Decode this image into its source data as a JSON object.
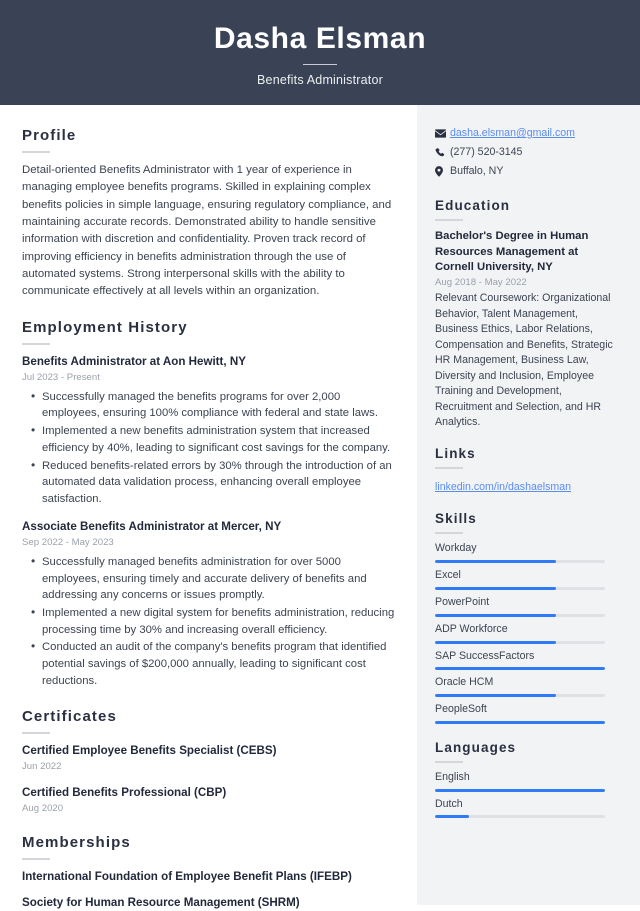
{
  "header": {
    "name": "Dasha Elsman",
    "job_title": "Benefits Administrator",
    "background_color": "#3a4355"
  },
  "accent_color": "#2f7bf6",
  "link_color": "#5b8dee",
  "main": {
    "profile": {
      "heading": "Profile",
      "text": "Detail-oriented Benefits Administrator with 1 year of experience in managing employee benefits programs. Skilled in explaining complex benefits policies in simple language, ensuring regulatory compliance, and maintaining accurate records. Demonstrated ability to handle sensitive information with discretion and confidentiality. Proven track record of improving efficiency in benefits administration through the use of automated systems. Strong interpersonal skills with the ability to communicate effectively at all levels within an organization."
    },
    "employment": {
      "heading": "Employment History",
      "jobs": [
        {
          "title": "Benefits Administrator at Aon Hewitt, NY",
          "date": "Jul 2023 - Present",
          "bullets": [
            "Successfully managed the benefits programs for over 2,000 employees, ensuring 100% compliance with federal and state laws.",
            "Implemented a new benefits administration system that increased efficiency by 40%, leading to significant cost savings for the company.",
            "Reduced benefits-related errors by 30% through the introduction of an automated data validation process, enhancing overall employee satisfaction."
          ]
        },
        {
          "title": "Associate Benefits Administrator at Mercer, NY",
          "date": "Sep 2022 - May 2023",
          "bullets": [
            "Successfully managed benefits administration for over 5000 employees, ensuring timely and accurate delivery of benefits and addressing any concerns or issues promptly.",
            "Implemented a new digital system for benefits administration, reducing processing time by 30% and increasing overall efficiency.",
            "Conducted an audit of the company's benefits program that identified potential savings of $200,000 annually, leading to significant cost reductions."
          ]
        }
      ]
    },
    "certificates": {
      "heading": "Certificates",
      "items": [
        {
          "title": "Certified Employee Benefits Specialist (CEBS)",
          "date": "Jun 2022"
        },
        {
          "title": "Certified Benefits Professional (CBP)",
          "date": "Aug 2020"
        }
      ]
    },
    "memberships": {
      "heading": "Memberships",
      "items": [
        {
          "title": "International Foundation of Employee Benefit Plans (IFEBP)"
        },
        {
          "title": "Society for Human Resource Management (SHRM)"
        }
      ]
    }
  },
  "aside": {
    "contact": [
      {
        "icon": "envelope-icon",
        "text": "dasha.elsman@gmail.com",
        "is_link": true
      },
      {
        "icon": "phone-icon",
        "text": "(277) 520-3145",
        "is_link": false
      },
      {
        "icon": "location-pin-icon",
        "text": "Buffalo, NY",
        "is_link": false
      }
    ],
    "education": {
      "heading": "Education",
      "degree": "Bachelor's Degree in Human Resources Management at Cornell University, NY",
      "date": "Aug 2018 - May 2022",
      "description": "Relevant Coursework: Organizational Behavior, Talent Management, Business Ethics, Labor Relations, Compensation and Benefits, Strategic HR Management, Business Law, Diversity and Inclusion, Employee Training and Development, Recruitment and Selection, and HR Analytics."
    },
    "links": {
      "heading": "Links",
      "items": [
        {
          "label": "linkedin.com/in/dashaelsman"
        }
      ]
    },
    "skills": {
      "heading": "Skills",
      "items": [
        {
          "label": "Workday",
          "level": 71
        },
        {
          "label": "Excel",
          "level": 71
        },
        {
          "label": "PowerPoint",
          "level": 71
        },
        {
          "label": "ADP Workforce",
          "level": 71
        },
        {
          "label": "SAP SuccessFactors",
          "level": 100
        },
        {
          "label": "Oracle HCM",
          "level": 71
        },
        {
          "label": "PeopleSoft",
          "level": 100
        }
      ]
    },
    "languages": {
      "heading": "Languages",
      "items": [
        {
          "label": "English",
          "level": 100
        },
        {
          "label": "Dutch",
          "level": 20
        }
      ]
    }
  }
}
